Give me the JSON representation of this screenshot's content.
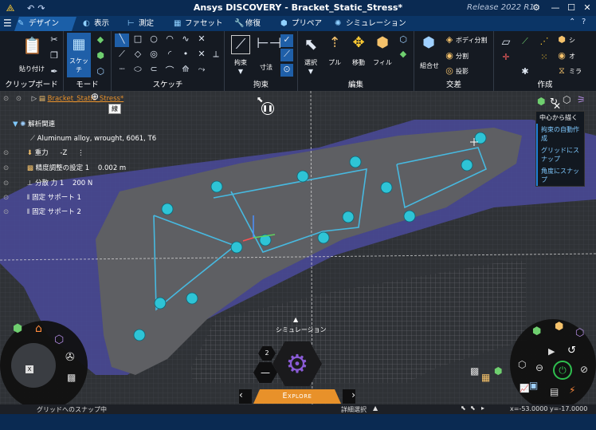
{
  "titlebar": {
    "title": "Ansys DISCOVERY - Bracket_Static_Stress*",
    "release": "Release 2022 R1",
    "icon": "ansys-logo-icon",
    "minimize": "—",
    "maximize": "☐",
    "close": "✕"
  },
  "tabs": [
    {
      "label": "デザイン",
      "icon": "pencil-icon"
    },
    {
      "label": "表示",
      "icon": "view-icon"
    },
    {
      "label": "測定",
      "icon": "ruler-icon"
    },
    {
      "label": "ファセット",
      "icon": "facet-icon"
    },
    {
      "label": "修復",
      "icon": "wrench-icon"
    },
    {
      "label": "プリペア",
      "icon": "prepare-icon"
    },
    {
      "label": "シミュレーション",
      "icon": "simulation-icon"
    }
  ],
  "ribbon": {
    "clipboard": {
      "label": "クリップボード",
      "paste": "貼り付け"
    },
    "mode": {
      "label": "モード",
      "sketch": "スケッチ"
    },
    "sketch": {
      "label": "スケッチ"
    },
    "constraint": {
      "label": "拘束",
      "constrain": "拘束",
      "dimension": "寸法"
    },
    "edit": {
      "label": "編集",
      "select": "選択",
      "pull": "プル",
      "move": "移動",
      "fill": "フィル"
    },
    "intersect": {
      "label": "交差",
      "combine": "組合せ",
      "split_body": "ボディ分割",
      "split": "分割",
      "project": "投影"
    },
    "create": {
      "label": "作成",
      "shell": "シ",
      "offset": "オ",
      "mirror": "ミラ"
    }
  },
  "tree": {
    "file": "Bracket_Static_Stress*",
    "tooltip": "線",
    "root": "解析関連",
    "items": [
      {
        "label": "Aluminum alloy, wrought, 6061, T6",
        "value": ""
      },
      {
        "label": "重力",
        "value": "-Z"
      },
      {
        "label": "精度調整の設定 1",
        "value": "0.002 m"
      },
      {
        "label": "分散 力 1",
        "value": "200 N"
      },
      {
        "label": "固定 サポート 1",
        "value": ""
      },
      {
        "label": "固定 サポート 2",
        "value": ""
      }
    ]
  },
  "popmenu": {
    "items": [
      "中心から描く",
      "拘束の自動作成",
      "グリッドにスナップ",
      "角度にスナップ"
    ]
  },
  "viewport": {
    "sim_label": "シミュレーション",
    "explore": "Explore",
    "counter": "2"
  },
  "status": {
    "left": "グリッドへのスナップ中",
    "detail": "詳細選択",
    "coords": "x=-53.0000  y=-17.0000"
  },
  "colors": {
    "title_bg": "#0a2a52",
    "tab_bg": "#0b3566",
    "ribbon_bg": "#151a22",
    "part": "#5e5f63",
    "shadow": "#4a4a9a",
    "sketch": "#47b9e0",
    "accent": "#e8912a"
  }
}
